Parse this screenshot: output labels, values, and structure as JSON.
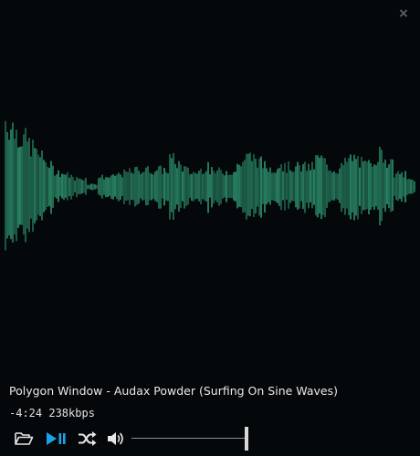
{
  "window": {
    "close_glyph": "×"
  },
  "track": {
    "title": "Polygon Window - Audax Powder (Surfing On Sine Waves)",
    "time_remaining": "-4:24",
    "bitrate": "238kbps"
  },
  "controls": {
    "open_icon": "folder-open-icon",
    "play_pause_icon": "play-pause-icon",
    "shuffle_icon": "shuffle-icon",
    "volume_icon": "volume-icon",
    "volume_level": 1.0
  },
  "colors": {
    "background": "#05080b",
    "waveform": "#3fcf9a",
    "accent": "#1aa3e8",
    "icon": "#e6e6e6"
  }
}
